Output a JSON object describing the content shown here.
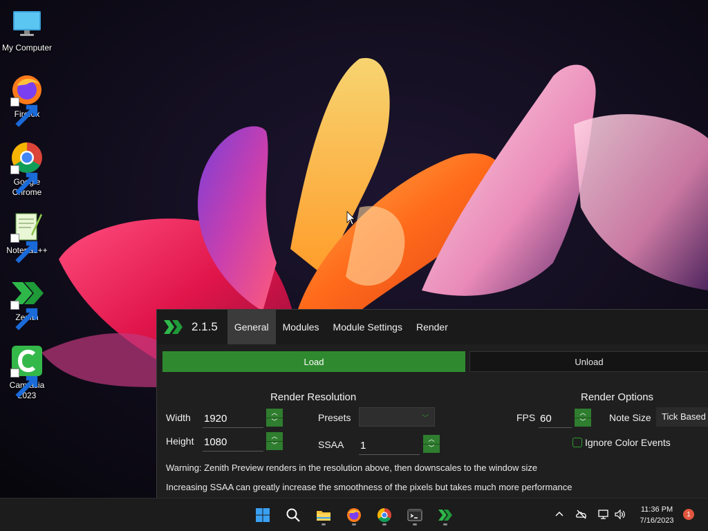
{
  "desktop": {
    "icons": [
      {
        "label": "My Computer",
        "icon": "monitor-icon"
      },
      {
        "label": "Firefox",
        "icon": "firefox-icon"
      },
      {
        "label": "Google\nChrome",
        "icon": "chrome-icon"
      },
      {
        "label": "Notepad++",
        "icon": "notepad-plus-plus-icon"
      },
      {
        "label": "Zenith",
        "icon": "zenith-icon"
      },
      {
        "label": "Camtasia\n2023",
        "icon": "camtasia-icon"
      }
    ]
  },
  "zenith": {
    "version": "2.1.5",
    "tabs": [
      {
        "label": "General",
        "active": true
      },
      {
        "label": "Modules",
        "active": false
      },
      {
        "label": "Module Settings",
        "active": false
      },
      {
        "label": "Render",
        "active": false
      }
    ],
    "load_label": "Load",
    "unload_label": "Unload",
    "render_resolution": {
      "title": "Render Resolution",
      "width_label": "Width",
      "width_value": "1920",
      "height_label": "Height",
      "height_value": "1080",
      "presets_label": "Presets",
      "presets_value": "",
      "ssaa_label": "SSAA",
      "ssaa_value": "1"
    },
    "render_options": {
      "title": "Render Options",
      "fps_label": "FPS",
      "fps_value": "60",
      "note_size_label": "Note Size",
      "note_size_value": "Tick Based",
      "ignore_color_label": "Ignore Color Events",
      "ignore_color_checked": false
    },
    "warning_1": "Warning: Zenith Preview renders in the resolution above, then downscales to the window size",
    "warning_2": "Increasing SSAA can greatly increase the smoothness of the pixels but takes much more performance"
  },
  "taskbar": {
    "pinned": [
      "windows-start-icon",
      "search-icon",
      "file-explorer-icon",
      "firefox-icon",
      "chrome-icon",
      "terminal-icon",
      "zenith-icon"
    ],
    "clock_time": "11:36 PM",
    "clock_date": "7/16/2023",
    "notification_count": "1"
  },
  "colors": {
    "accent_green": "#2f8a2f",
    "window_bg": "#1f1f1f",
    "taskbar_bg": "#1c1c1c"
  }
}
